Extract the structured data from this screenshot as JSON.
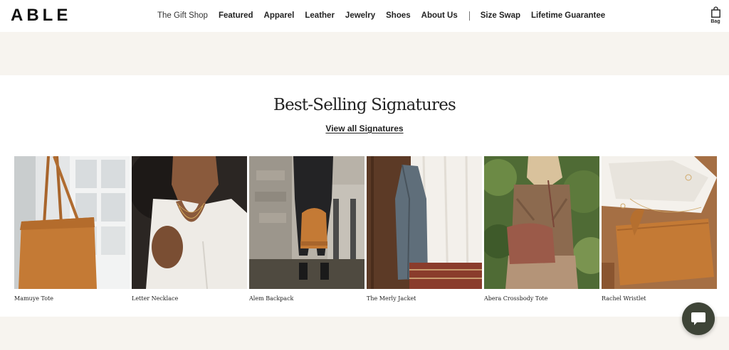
{
  "brand": {
    "logo_text": "ABLE"
  },
  "nav": {
    "items": [
      {
        "label": "The Gift Shop"
      },
      {
        "label": "Featured"
      },
      {
        "label": "Apparel"
      },
      {
        "label": "Leather"
      },
      {
        "label": "Jewelry"
      },
      {
        "label": "Shoes"
      },
      {
        "label": "About Us"
      }
    ],
    "secondary_items": [
      {
        "label": "Size Swap"
      },
      {
        "label": "Lifetime Guarantee"
      }
    ]
  },
  "bag": {
    "label": "Bag",
    "icon": "shopping-bag-icon"
  },
  "section": {
    "title": "Best-Selling Signatures",
    "view_all_label": "View all Signatures"
  },
  "products": [
    {
      "name": "Mamuye Tote"
    },
    {
      "name": "Letter Necklace"
    },
    {
      "name": "Alem Backpack"
    },
    {
      "name": "The Merly Jacket"
    },
    {
      "name": "Abera Crossbody Tote"
    },
    {
      "name": "Rachel Wristlet"
    }
  ],
  "chat": {
    "icon": "chat-bubble-icon"
  },
  "colors": {
    "band_background": "#f7f4ef",
    "chat_button": "#3e4437",
    "leather_tan": "#c47a35"
  }
}
